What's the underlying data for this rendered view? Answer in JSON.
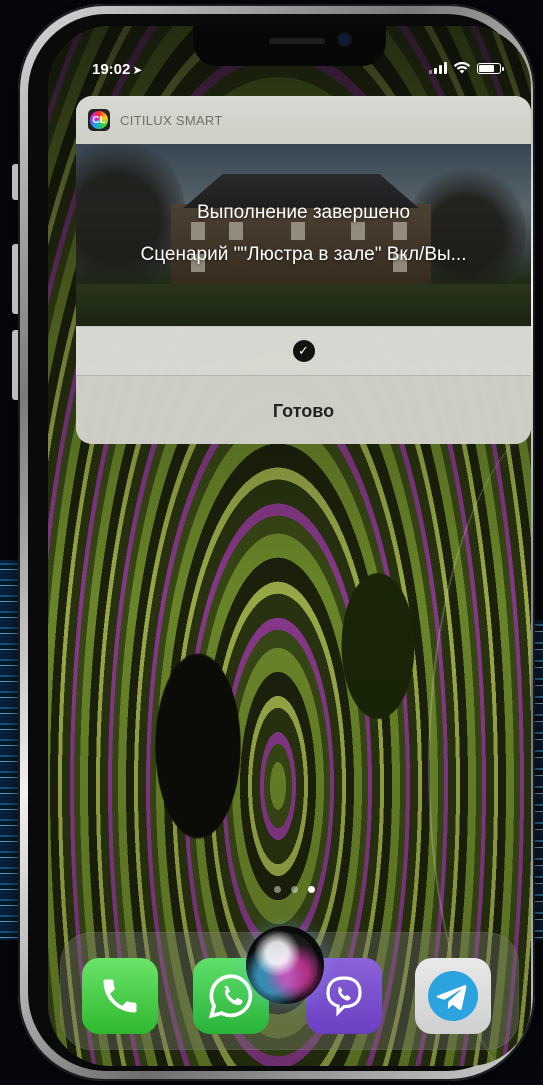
{
  "status_bar": {
    "time": "19:02",
    "location_icon": "location-arrow-icon",
    "signal_icon": "cellular-signal-icon",
    "wifi_icon": "wifi-icon",
    "battery_icon": "battery-icon"
  },
  "notification": {
    "app_name": "CITILUX SMART",
    "app_icon_label": "CL",
    "title": "Выполнение завершено",
    "body": "Сценарий \"\"Люстра в зале\" Вкл/Вы...",
    "check_icon": "checkmark-circle-icon",
    "done_label": "Готово"
  },
  "home": {
    "page_count": 3,
    "active_page": 3
  },
  "dock": {
    "apps": [
      {
        "name": "phone-app",
        "icon": "phone-icon",
        "color": "#34c759"
      },
      {
        "name": "whatsapp-app",
        "icon": "whatsapp-icon",
        "color": "#25d366"
      },
      {
        "name": "viber-app",
        "icon": "viber-icon",
        "color": "#7360f2"
      },
      {
        "name": "telegram-app",
        "icon": "telegram-icon",
        "color": "#2aa3df"
      }
    ],
    "siri_icon": "siri-orb-icon"
  },
  "colors": {
    "accent_green": "#34c759",
    "viber_purple": "#7360f2",
    "telegram_blue": "#2aa3df"
  }
}
